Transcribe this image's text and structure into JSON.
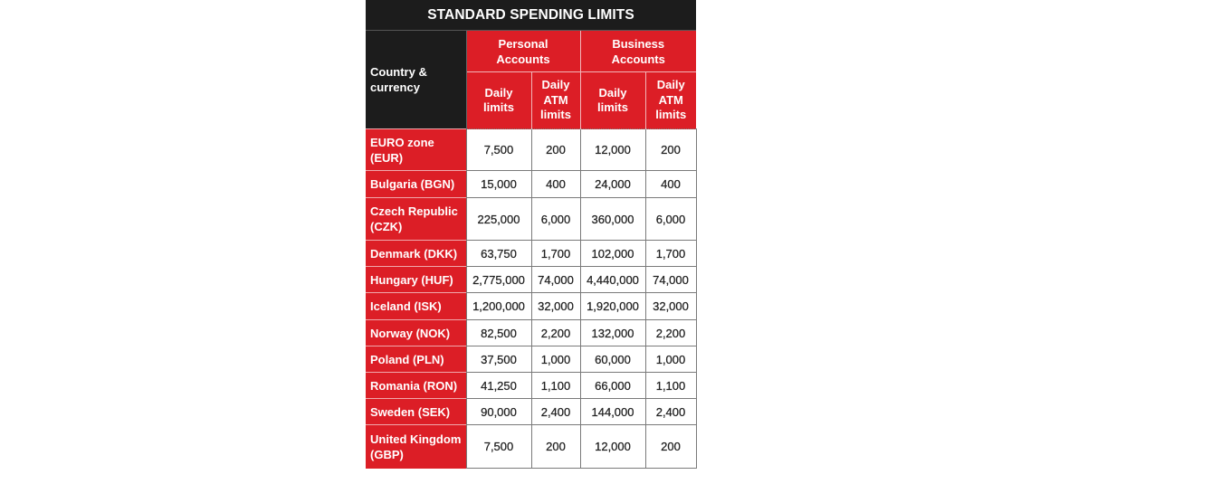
{
  "title": "STANDARD SPENDING LIMITS",
  "header": {
    "country_label": "Country & currency",
    "groups": [
      "Personal Accounts",
      "Business Accounts"
    ],
    "subcolumns": [
      "Daily limits",
      "Daily ATM limits",
      "Daily limits",
      "Daily ATM limits"
    ]
  },
  "colors": {
    "red": "#dc1e26",
    "dark": "#1c1c1c"
  },
  "rows": [
    {
      "country": "EURO zone (EUR)",
      "values": [
        "7,500",
        "200",
        "12,000",
        "200"
      ]
    },
    {
      "country": "Bulgaria (BGN)",
      "values": [
        "15,000",
        "400",
        "24,000",
        "400"
      ]
    },
    {
      "country": "Czech Republic (CZK)",
      "values": [
        "225,000",
        "6,000",
        "360,000",
        "6,000"
      ]
    },
    {
      "country": "Denmark (DKK)",
      "values": [
        "63,750",
        "1,700",
        "102,000",
        "1,700"
      ]
    },
    {
      "country": "Hungary (HUF)",
      "values": [
        "2,775,000",
        "74,000",
        "4,440,000",
        "74,000"
      ]
    },
    {
      "country": "Iceland (ISK)",
      "values": [
        "1,200,000",
        "32,000",
        "1,920,000",
        "32,000"
      ]
    },
    {
      "country": "Norway (NOK)",
      "values": [
        "82,500",
        "2,200",
        "132,000",
        "2,200"
      ]
    },
    {
      "country": "Poland (PLN)",
      "values": [
        "37,500",
        "1,000",
        "60,000",
        "1,000"
      ]
    },
    {
      "country": "Romania (RON)",
      "values": [
        "41,250",
        "1,100",
        "66,000",
        "1,100"
      ]
    },
    {
      "country": "Sweden (SEK)",
      "values": [
        "90,000",
        "2,400",
        "144,000",
        "2,400"
      ]
    },
    {
      "country": "United Kingdom (GBP)",
      "values": [
        "7,500",
        "200",
        "12,000",
        "200"
      ]
    }
  ]
}
